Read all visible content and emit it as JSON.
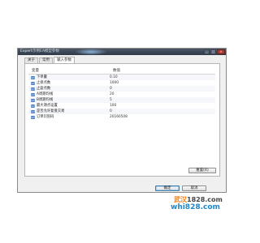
{
  "window": {
    "app_label": "Expert",
    "title": "示例EA模型参数",
    "buttons": {
      "minimize": "_",
      "maximize": "□",
      "close": "×"
    }
  },
  "tabs": [
    {
      "label": "关于",
      "active": false
    },
    {
      "label": "常用",
      "active": false
    },
    {
      "label": "输入参数",
      "active": true
    }
  ],
  "grid": {
    "headers": {
      "variable": "变量",
      "value": "数值"
    },
    "rows": [
      {
        "icon": "123",
        "name": "下单量",
        "value": "0.10"
      },
      {
        "icon": "123",
        "name": "止损点数",
        "value": "1000"
      },
      {
        "icon": "123",
        "name": "止盈点数",
        "value": "0"
      },
      {
        "icon": "123",
        "name": "A周期均线",
        "value": "20"
      },
      {
        "icon": "123",
        "name": "B周期均线",
        "value": "5"
      },
      {
        "icon": "123",
        "name": "最大滑点设置",
        "value": "100"
      },
      {
        "icon": "123",
        "name": "是否允许复盘交易",
        "value": "0"
      },
      {
        "icon": "123",
        "name": "订单识别码",
        "value": "20160508"
      }
    ]
  },
  "buttons": {
    "reset": "重置(R)",
    "ok": "确定",
    "cancel": "取消"
  },
  "watermark": {
    "line1_a": "武汉",
    "line1_b": "1828",
    "line1_c": ".com",
    "line2": "whi828.com"
  },
  "colors": {
    "title_bar": "#2f3947",
    "icon": "#4a7cc7",
    "watermark_orange": "#ff7700",
    "watermark_blue": "#1f86c9"
  }
}
